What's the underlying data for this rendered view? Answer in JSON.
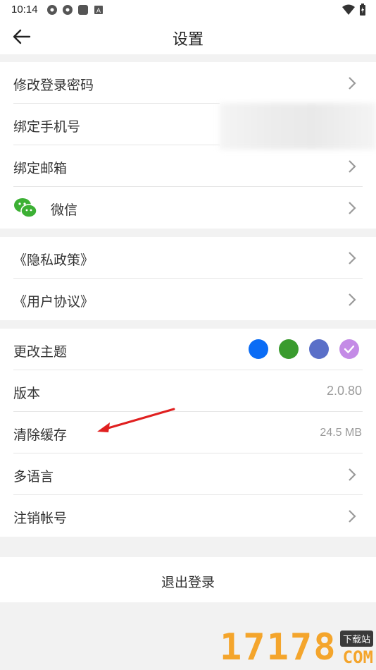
{
  "status_bar": {
    "time": "10:14",
    "icons": [
      "app-icon",
      "app-icon",
      "app-icon",
      "app-icon"
    ],
    "right_icons": [
      "wifi-icon",
      "battery-icon"
    ]
  },
  "header": {
    "title": "设置"
  },
  "account": {
    "items": [
      {
        "label": "修改登录密码"
      },
      {
        "label": "绑定手机号"
      },
      {
        "label": "绑定邮箱"
      },
      {
        "label": "微信"
      }
    ]
  },
  "policy": {
    "items": [
      {
        "label": "《隐私政策》"
      },
      {
        "label": "《用户协议》"
      }
    ]
  },
  "general": {
    "theme_label": "更改主题",
    "theme_colors": [
      "#0a6cf5",
      "#3a9b2e",
      "#5a6fc8",
      "#c48be6"
    ],
    "selected_theme_index": 3,
    "version_label": "版本",
    "version_value": "2.0.80",
    "cache_label": "清除缓存",
    "cache_value": "24.5 MB",
    "language_label": "多语言",
    "cancel_account_label": "注销帐号"
  },
  "logout": {
    "label": "退出登录"
  },
  "watermark": {
    "number": "17178",
    "tag": "下载站",
    "domain": "COM"
  }
}
